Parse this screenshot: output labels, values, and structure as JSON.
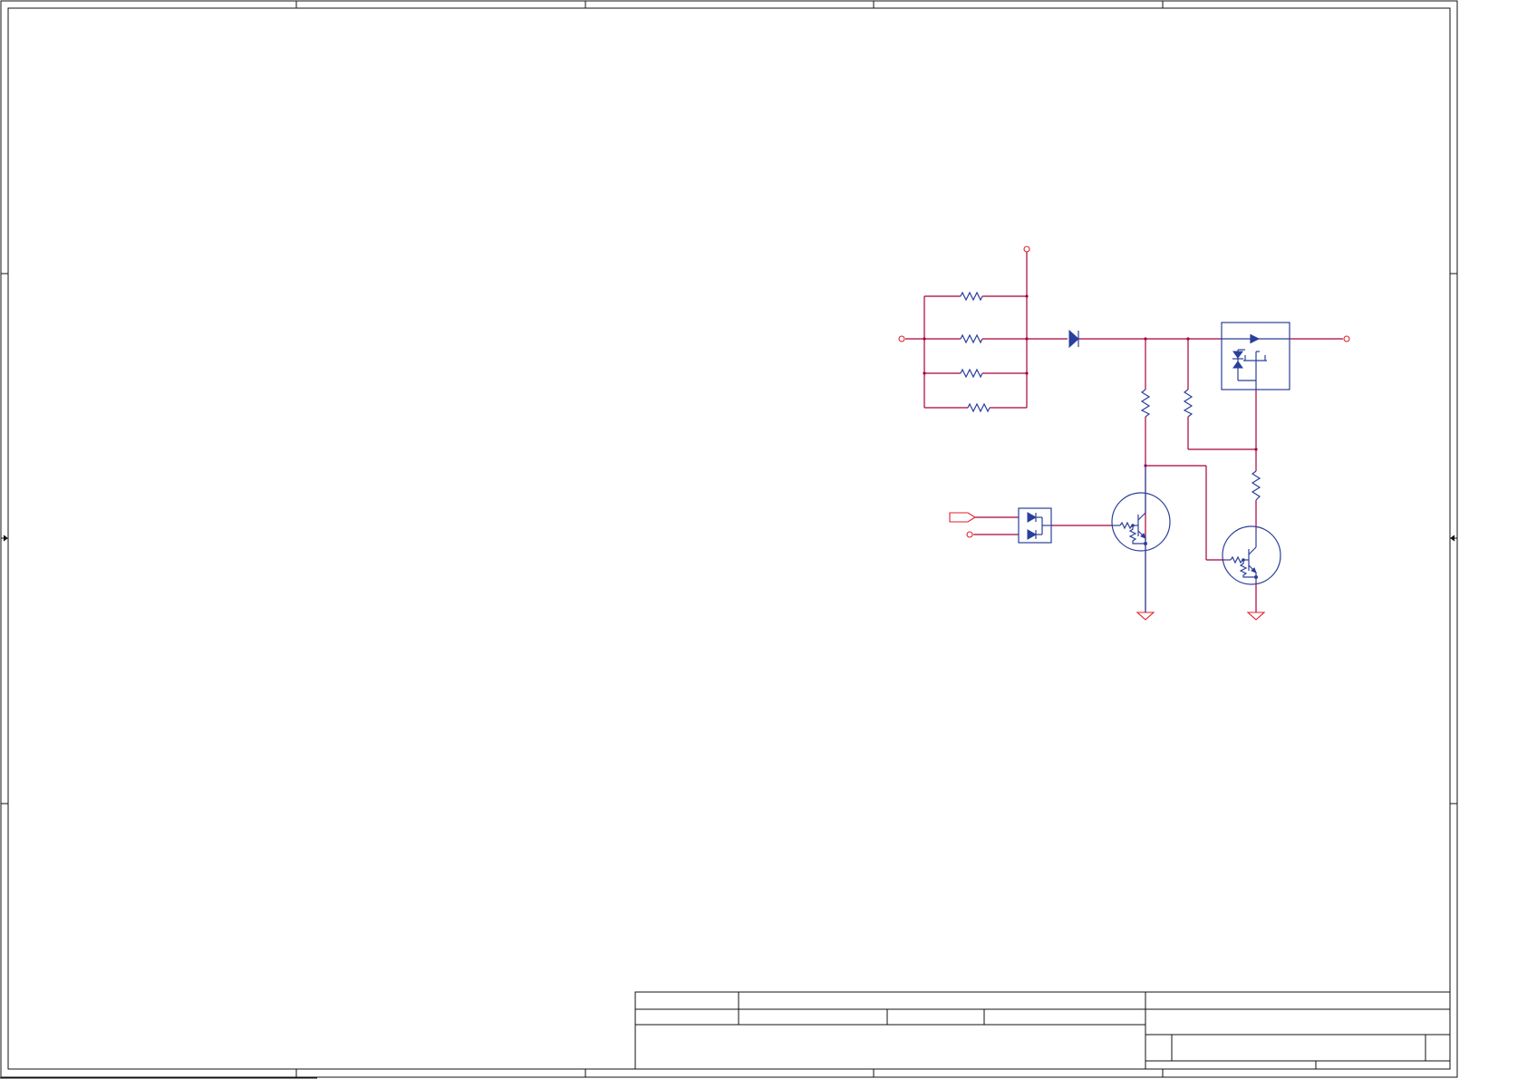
{
  "document": {
    "viewer_note": "",
    "border_zones": {
      "columns": 5,
      "rows": 4
    }
  },
  "schematic": {
    "colors": {
      "wire": "#a8003c",
      "net_symbol": "#e0202a",
      "component": "#2a3f9a",
      "frame": "#111111"
    },
    "components": [
      {
        "kind": "resistor-icon"
      },
      {
        "kind": "resistor-icon"
      },
      {
        "kind": "resistor-icon"
      },
      {
        "kind": "resistor-icon"
      },
      {
        "kind": "diode-icon"
      },
      {
        "kind": "resistor-icon"
      },
      {
        "kind": "resistor-icon"
      },
      {
        "kind": "resistor-icon"
      },
      {
        "kind": "mosfet-icon"
      },
      {
        "kind": "dual-diode-icon"
      },
      {
        "kind": "npn-transistor-icon"
      },
      {
        "kind": "npn-transistor-icon"
      },
      {
        "kind": "ground-icon"
      },
      {
        "kind": "ground-icon"
      }
    ]
  },
  "title_block": {
    "cells": [
      "",
      "",
      "",
      "",
      "",
      "",
      "",
      "",
      "",
      "",
      ""
    ]
  }
}
